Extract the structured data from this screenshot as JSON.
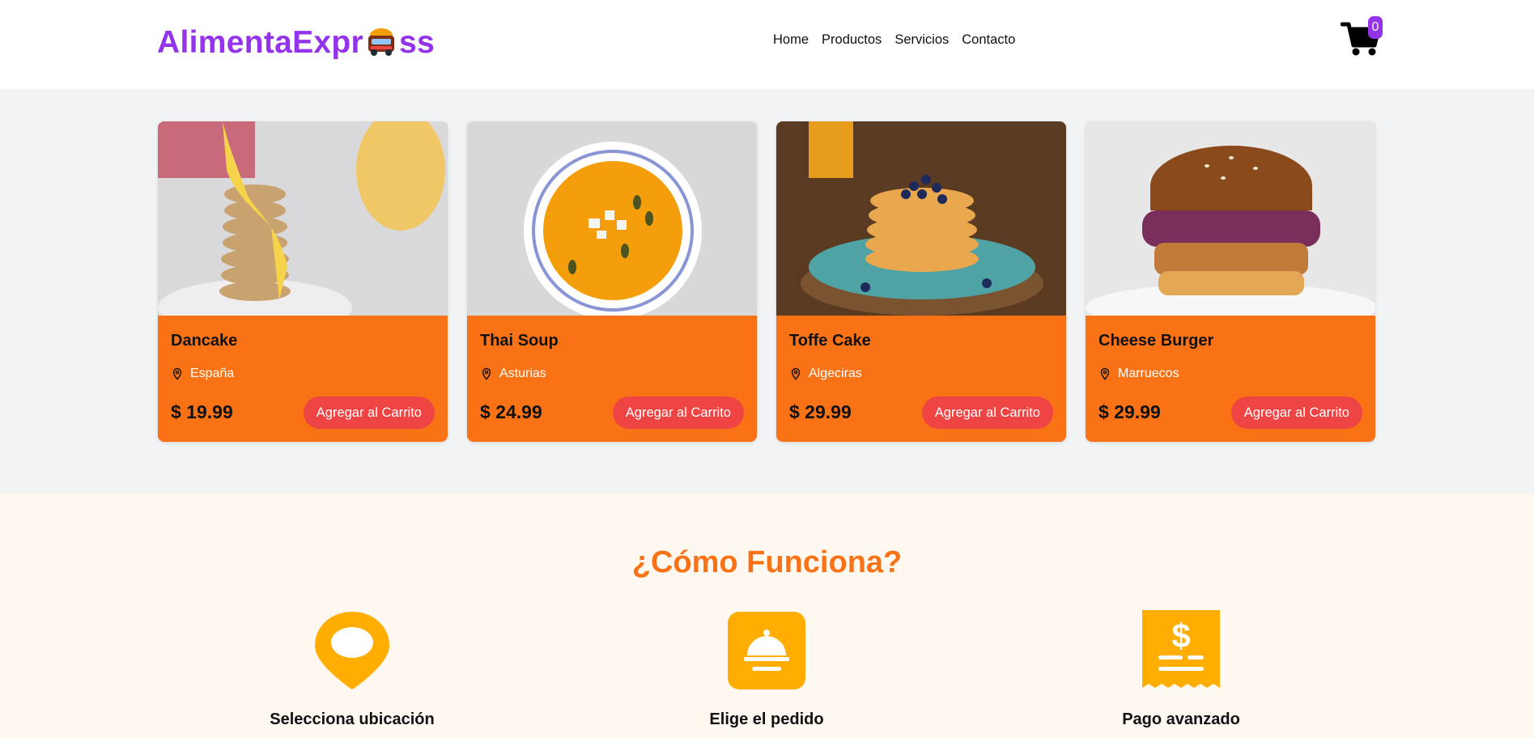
{
  "brand": {
    "name_part1": "AlimentaExpr",
    "name_part2": "ss",
    "color": "#9333ea"
  },
  "nav": [
    {
      "label": "Home"
    },
    {
      "label": "Productos"
    },
    {
      "label": "Servicios"
    },
    {
      "label": "Contacto"
    }
  ],
  "cart": {
    "count": "0"
  },
  "products": [
    {
      "name": "Dancake",
      "location": "España",
      "price": "$ 19.99",
      "button": "Agregar al Carrito"
    },
    {
      "name": "Thai Soup",
      "location": "Asturias",
      "price": "$ 24.99",
      "button": "Agregar al Carrito"
    },
    {
      "name": "Toffe Cake",
      "location": "Algeciras",
      "price": "$ 29.99",
      "button": "Agregar al Carrito"
    },
    {
      "name": "Cheese Burger",
      "location": "Marruecos",
      "price": "$ 29.99",
      "button": "Agregar al Carrito"
    }
  ],
  "how": {
    "title": "¿Cómo Funciona?",
    "steps": [
      {
        "label": "Selecciona ubicación",
        "icon": "map-pin-icon"
      },
      {
        "label": "Elige el pedido",
        "icon": "food-cloche-icon"
      },
      {
        "label": "Pago avanzado",
        "icon": "receipt-dollar-icon"
      }
    ]
  },
  "colors": {
    "accent": "#f97316",
    "button": "#ef4444",
    "brand": "#9333ea",
    "icon": "#ffad00"
  }
}
